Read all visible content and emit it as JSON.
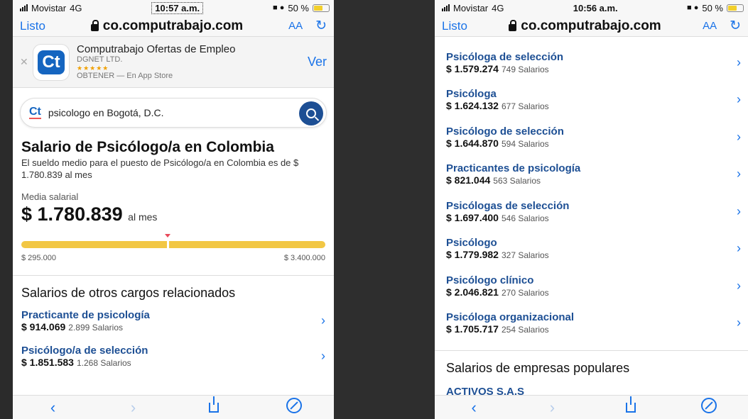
{
  "colors": {
    "link": "#1d4f94",
    "accent": "#1a73e8",
    "range_bar": "#f2c744",
    "pointer": "#e8495a"
  },
  "left": {
    "status": {
      "carrier": "Movistar",
      "network": "4G",
      "time": "10:57 a.m.",
      "battery": "50 %"
    },
    "browser": {
      "done": "Listo",
      "domain": "co.computrabajo.com",
      "text_size": "AA"
    },
    "app_banner": {
      "name": "Computrabajo Ofertas de Empleo",
      "developer": "DGNET LTD.",
      "stars": "★★★★★",
      "get": "OBTENER — En App Store",
      "view": "Ver",
      "icon_text": "Ct"
    },
    "search": {
      "logo": "Ct",
      "query": "psicologo en Bogotá, D.C."
    },
    "salary": {
      "title": "Salario de Psicólogo/a en Colombia",
      "description": "El sueldo medio para el puesto de Psicólogo/a en Colombia es de $ 1.780.839 al mes",
      "avg_label": "Media salarial",
      "avg_value": "$ 1.780.839",
      "avg_unit": "al mes",
      "min": "$ 295.000",
      "max": "$ 3.400.000",
      "position_fraction": 0.48
    },
    "related": {
      "title": "Salarios de otros cargos relacionados",
      "items": [
        {
          "title": "Practicante de psicología",
          "salary": "$ 914.069",
          "count": "2.899 Salarios"
        },
        {
          "title": "Psicólogo/a de selección",
          "salary": "$ 1.851.583",
          "count": "1.268 Salarios"
        }
      ]
    }
  },
  "right": {
    "status": {
      "carrier": "Movistar",
      "network": "4G",
      "time": "10:56 a.m.",
      "battery": "50 %"
    },
    "browser": {
      "done": "Listo",
      "domain": "co.computrabajo.com",
      "text_size": "AA"
    },
    "items": [
      {
        "title": "Psicóloga de selección",
        "salary": "$ 1.579.274",
        "count": "749 Salarios"
      },
      {
        "title": "Psicóloga",
        "salary": "$ 1.624.132",
        "count": "677 Salarios"
      },
      {
        "title": "Psicólogo de selección",
        "salary": "$ 1.644.870",
        "count": "594 Salarios"
      },
      {
        "title": "Practicantes de psicología",
        "salary": "$ 821.044",
        "count": "563 Salarios"
      },
      {
        "title": "Psicólogas de selección",
        "salary": "$ 1.697.400",
        "count": "546 Salarios"
      },
      {
        "title": "Psicólogo",
        "salary": "$ 1.779.982",
        "count": "327 Salarios"
      },
      {
        "title": "Psicólogo clínico",
        "salary": "$ 2.046.821",
        "count": "270 Salarios"
      },
      {
        "title": "Psicóloga organizacional",
        "salary": "$ 1.705.717",
        "count": "254 Salarios"
      }
    ],
    "companies_title": "Salarios de empresas populares",
    "cut_company": "ACTIVOS S.A.S"
  }
}
